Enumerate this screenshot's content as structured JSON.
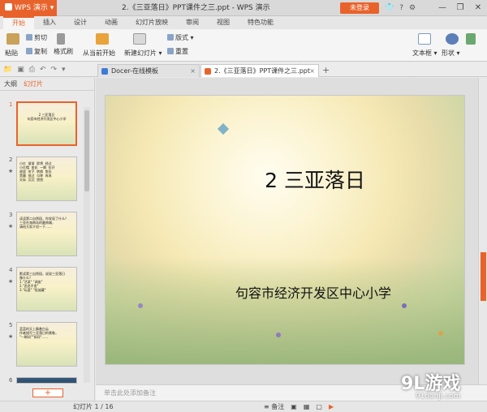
{
  "app": {
    "name": "WPS 演示",
    "title": "2.《三亚落日》PPT课件之三.ppt - WPS 演示",
    "login": "未登录"
  },
  "window_controls": [
    "—",
    "❐",
    "✕"
  ],
  "menu_tabs": [
    "开始",
    "插入",
    "设计",
    "动画",
    "幻灯片放映",
    "审阅",
    "视图",
    "特色功能"
  ],
  "ribbon": {
    "paste": "粘贴",
    "cut": "剪切",
    "copy": "复制",
    "format_painter": "格式刷",
    "from_current": "从当前开始",
    "new_slide": "新建幻灯片",
    "layout": "版式",
    "reset": "重置",
    "font_size": "0",
    "textbox": "文本框",
    "shape": "形状"
  },
  "doc_tabs": [
    {
      "label": "Docer-在线模板",
      "close": "×"
    },
    {
      "label": "2.《三亚落日》PPT课件之三.ppt",
      "close": "×"
    }
  ],
  "new_tab": "+",
  "left_panel": {
    "tab_outline": "大纲",
    "tab_slides": "幻灯片",
    "add": "+"
  },
  "thumbnails": [
    {
      "num": "1",
      "text": "2 三亚落日\n句容市经济开发区中心小学"
    },
    {
      "num": "2",
      "text": "小红  渐渐  即将  经过\n小红帽  变化  一瞬  拉开\n收拢  帘子  转换  鱼肚\n黑幕  掠过  匀称  冉冉\n天际  沉沉  悠悠"
    },
    {
      "num": "3",
      "text": "读读第二自然段，你发现了什么？\n三亚在海南岛的最南端，\n请给大家介绍一下……"
    },
    {
      "num": "4",
      "text": "默读第三自然段，说说三亚落日\n像什么？\n1.\"活泼\" \"调皮\"\n2.\"恋恋不舍\"\n3.\"玩耍\" \"捉迷藏\""
    },
    {
      "num": "5",
      "text": "蓝蓝的天上飘着白云\n作者描写三亚落日的景象，\n\"一瞬间\"\"如同\"……"
    },
    {
      "num": "6",
      "text": ""
    }
  ],
  "slide": {
    "title": "2 三亚落日",
    "subtitle": "句容市经济开发区中心小学"
  },
  "notes_placeholder": "单击此处添加备注",
  "status": {
    "page": "幻灯片 1 / 16",
    "notes": "备注"
  },
  "watermark": {
    "logo": "9L游戏",
    "url": "91danji.com"
  }
}
